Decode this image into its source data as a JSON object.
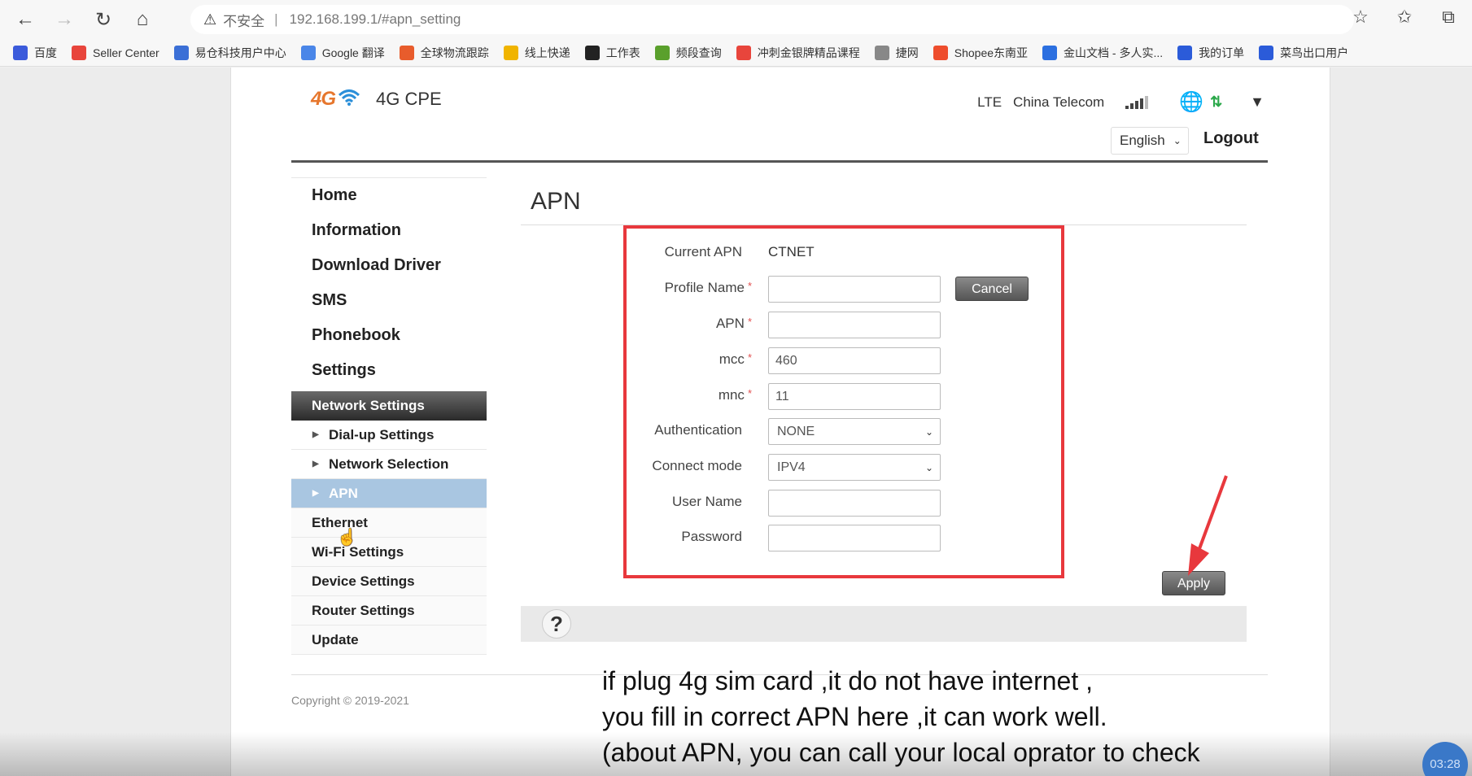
{
  "browser": {
    "security_warning": "不安全",
    "separator": "|",
    "url": "192.168.199.1/#apn_setting",
    "bookmarks": [
      {
        "label": "百度",
        "color": "#3b5bdb"
      },
      {
        "label": "Seller Center",
        "color": "#e8453c"
      },
      {
        "label": "易仓科技用户中心",
        "color": "#3b6fd6"
      },
      {
        "label": "Google 翻译",
        "color": "#4a86e8"
      },
      {
        "label": "全球物流跟踪",
        "color": "#e85c2c"
      },
      {
        "label": "线上快递",
        "color": "#f0b400"
      },
      {
        "label": "工作表",
        "color": "#222222"
      },
      {
        "label": "频段查询",
        "color": "#5aa02c"
      },
      {
        "label": "冲刺金银牌精品课程",
        "color": "#e8453c"
      },
      {
        "label": "捷网",
        "color": "#888888"
      },
      {
        "label": "Shopee东南亚",
        "color": "#ee4d2d"
      },
      {
        "label": "金山文档 - 多人实...",
        "color": "#2b6fe0"
      },
      {
        "label": "我的订单",
        "color": "#2b5bd9"
      },
      {
        "label": "菜鸟出口用户",
        "color": "#2b5bd9"
      }
    ]
  },
  "header": {
    "logo_4g": "4G",
    "brand": "4G CPE",
    "network_type": "LTE",
    "operator": "China Telecom",
    "language": "English",
    "logout": "Logout"
  },
  "sidebar": {
    "items": [
      "Home",
      "Information",
      "Download Driver",
      "SMS",
      "Phonebook",
      "Settings"
    ],
    "section": "Network Settings",
    "sub_items": [
      "Dial-up Settings",
      "Network Selection",
      "APN"
    ],
    "groups": [
      "Ethernet",
      "Wi-Fi Settings",
      "Device Settings",
      "Router Settings",
      "Update"
    ]
  },
  "main": {
    "title": "APN",
    "current_apn_label": "Current APN",
    "current_apn_value": "CTNET",
    "profile_name_label": "Profile Name",
    "apn_label": "APN",
    "mcc_label": "mcc",
    "mcc_value": "460",
    "mnc_label": "mnc",
    "mnc_value": "11",
    "auth_label": "Authentication",
    "auth_value": "NONE",
    "connect_label": "Connect mode",
    "connect_value": "IPV4",
    "username_label": "User Name",
    "password_label": "Password",
    "required_mark": "*",
    "cancel": "Cancel",
    "apply": "Apply"
  },
  "footer": {
    "copyright": "Copyright © 2019-2021"
  },
  "caption": {
    "line1": "if plug 4g sim card ,it do not have internet ,",
    "line2": "you fill in correct APN here ,it can work well.",
    "line3": "(about APN, you can call your local oprator to check"
  },
  "video": {
    "time": "03:28"
  },
  "colors": {
    "highlight_red": "#e8383d",
    "active_blue": "#a9c6e1",
    "logo_orange": "#e6772e",
    "wifi_blue": "#2b8fd9"
  }
}
